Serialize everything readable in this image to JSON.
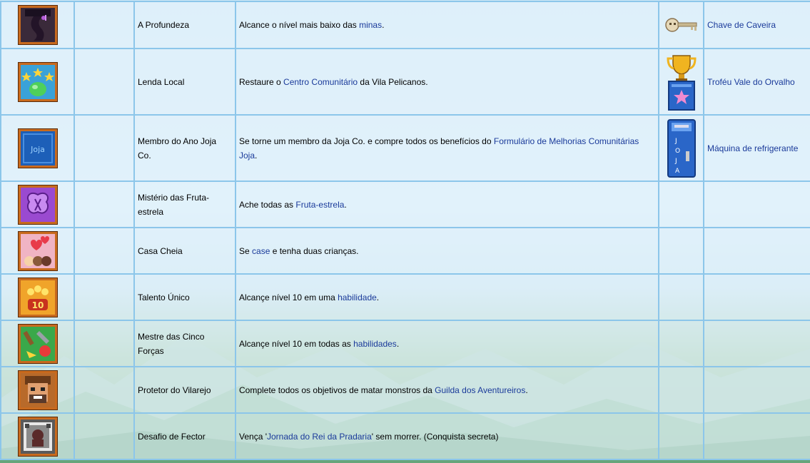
{
  "rows": [
    {
      "icon": "depths-icon",
      "name": "A Profundeza",
      "desc": [
        {
          "t": "Alcance o nível mais baixo das "
        },
        {
          "t": "minas",
          "link": true
        },
        {
          "t": "."
        }
      ],
      "reward_icon": "skull-key-icon",
      "reward": "Chave de Caveira"
    },
    {
      "icon": "local-legend-icon",
      "name": "Lenda Local",
      "desc": [
        {
          "t": "Restaure o "
        },
        {
          "t": "Centro Comunitário",
          "link": true
        },
        {
          "t": " da Vila Pelicanos."
        }
      ],
      "reward_icon": "trophy-icon",
      "reward": "Troféu Vale do Orvalho"
    },
    {
      "icon": "joja-icon",
      "name": "Membro do Ano Joja Co.",
      "desc": [
        {
          "t": "Se torne um membro da Joja Co. e compre todos os benefícios do "
        },
        {
          "t": "Formulário de Melhorias Comunitárias Joja",
          "link": true
        },
        {
          "t": "."
        }
      ],
      "reward_icon": "soda-machine-icon",
      "reward": "Máquina de refrigerante"
    },
    {
      "icon": "stardrop-icon",
      "name": "Mistério das Fruta-estrela",
      "desc": [
        {
          "t": "Ache todas as "
        },
        {
          "t": "Fruta-estrela",
          "link": true
        },
        {
          "t": "."
        }
      ],
      "reward_icon": "",
      "reward": ""
    },
    {
      "icon": "full-house-icon",
      "name": "Casa Cheia",
      "desc": [
        {
          "t": "Se "
        },
        {
          "t": "case",
          "link": true
        },
        {
          "t": " e tenha duas crianças."
        }
      ],
      "reward_icon": "",
      "reward": ""
    },
    {
      "icon": "singular-talent-icon",
      "name": "Talento Único",
      "desc": [
        {
          "t": "Alcançe nível 10 em uma "
        },
        {
          "t": "habilidade",
          "link": true
        },
        {
          "t": "."
        }
      ],
      "reward_icon": "",
      "reward": ""
    },
    {
      "icon": "five-skills-icon",
      "name": "Mestre das Cinco Forças",
      "desc": [
        {
          "t": "Alcançe nível 10 em todas as "
        },
        {
          "t": "habilidades",
          "link": true
        },
        {
          "t": "."
        }
      ],
      "reward_icon": "",
      "reward": ""
    },
    {
      "icon": "protector-icon",
      "name": "Protetor do Vilarejo",
      "desc": [
        {
          "t": "Complete todos os objetivos de matar monstros da "
        },
        {
          "t": "Guilda dos Aventureiros",
          "link": true
        },
        {
          "t": "."
        }
      ],
      "reward_icon": "",
      "reward": ""
    },
    {
      "icon": "fector-icon",
      "name": "Desafio de Fector",
      "desc": [
        {
          "t": "Vença '"
        },
        {
          "t": "Jornada do Rei da Pradaria",
          "link": true
        },
        {
          "t": "' sem morrer. (Conquista secreta)"
        }
      ],
      "reward_icon": "",
      "reward": ""
    }
  ],
  "colors": {
    "link": "#1a3a9a",
    "border": "#8cc6ea",
    "frame": "#c86a1e"
  }
}
